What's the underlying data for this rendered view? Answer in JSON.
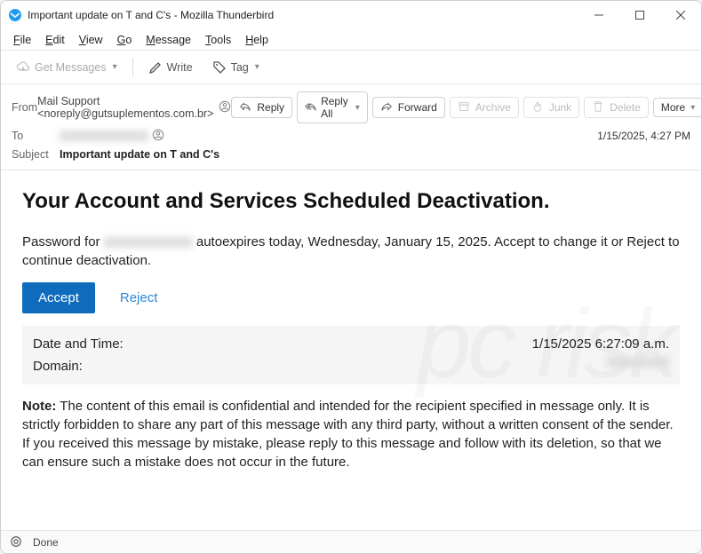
{
  "window": {
    "title": "Important update on T and C's - Mozilla Thunderbird"
  },
  "menubar": {
    "file": "File",
    "edit": "Edit",
    "view": "View",
    "go": "Go",
    "message": "Message",
    "tools": "Tools",
    "help": "Help"
  },
  "toolbar": {
    "get_messages": "Get Messages",
    "write": "Write",
    "tag": "Tag"
  },
  "labels": {
    "from": "From",
    "to": "To",
    "subject": "Subject"
  },
  "from": {
    "display": "Mail Support <noreply@gutsuplementos.com.br>"
  },
  "to": {
    "redacted": true
  },
  "actions": {
    "reply": "Reply",
    "reply_all": "Reply All",
    "forward": "Forward",
    "archive": "Archive",
    "junk": "Junk",
    "delete": "Delete",
    "more": "More"
  },
  "timestamp": "1/15/2025, 4:27 PM",
  "subject": "Important update on T and C's",
  "email": {
    "title": "Your Account and Services Scheduled Deactivation.",
    "para_pre": "Password for ",
    "para_post": " autoexpires today, Wednesday, January 15, 2025. Accept to change it or Reject to continue deactivation.",
    "accept": "Accept",
    "reject": "Reject",
    "dt_label": "Date and Time:",
    "dt_value": "1/15/2025 6:27:09 a.m.",
    "domain_label": "Domain:",
    "note_label": "Note:",
    "note_text": "  The content of this email is confidential and intended for the recipient specified in message only. It is strictly forbidden to share any part of this message with any third party, without a written consent of the sender. If you received this message by mistake, please reply to this message and follow with its deletion, so that we can ensure such a mistake does not occur in the future."
  },
  "statusbar": {
    "done": "Done"
  }
}
